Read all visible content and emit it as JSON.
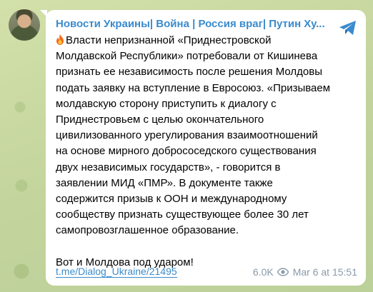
{
  "channel": {
    "name": "Новости Украины| Война | Россия враг| Путин Ху..."
  },
  "message": {
    "paragraph1": "Власти непризнанной «Приднестровской\nМолдавской Республики» потребовали от Кишинева\nпризнать ее независимость после решения Молдовы\nподать заявку на вступление в Евросоюз. «Призываем\nмолдавскую сторону приступить к диалогу с\nПриднестровьем с целью окончательного\nцивилизованного урегулирования взаимоотношений\nна основе мирного добрососедского существования\nдвух независимых государств», - говорится в\nзаявлении МИД «ПМР». В документе также\nсодержится призыв к ООН и международному\nсообществу признать существующее более 30 лет\nсамопровозглашенное образование.",
    "paragraph2": "Вот и Молдова под ударом!"
  },
  "footer": {
    "link": "t.me/Dialog_Ukraine/21495",
    "views": "6.0K",
    "timestamp": "Mar 6 at 15:51"
  },
  "icons": {
    "share": "share-telegram-icon",
    "fire": "fire-emoji-icon",
    "views": "eye-icon",
    "avatar": "channel-avatar"
  },
  "colors": {
    "accent": "#3a8bcd",
    "meta": "#8a9aa9",
    "bubble": "#ffffff"
  }
}
